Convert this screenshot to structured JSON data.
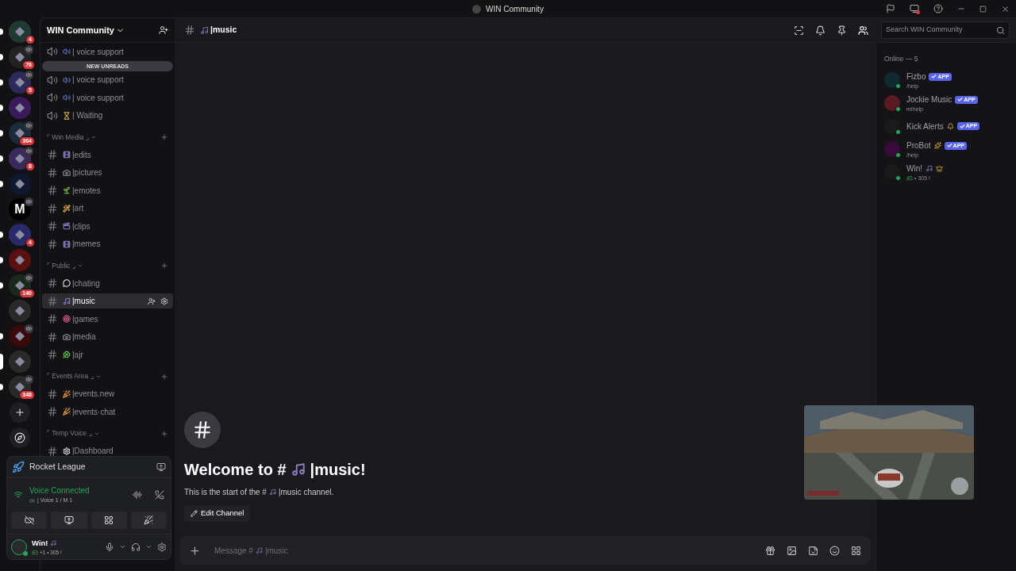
{
  "window": {
    "title": "WIN Community"
  },
  "servers": [
    {
      "badge": "4",
      "unread": true,
      "selected": false,
      "speaking": false
    },
    {
      "badge": "76",
      "unread": true,
      "selected": false,
      "speaking": true
    },
    {
      "badge": "5",
      "unread": true,
      "selected": false,
      "speaking": true
    },
    {
      "unread": true,
      "selected": false,
      "speaking": false
    },
    {
      "badge": "364",
      "unread": true,
      "selected": false,
      "speaking": true
    },
    {
      "badge": "8",
      "unread": true,
      "selected": false,
      "speaking": true
    },
    {
      "unread": true,
      "selected": false,
      "speaking": false
    },
    {
      "label": "M",
      "unread": false,
      "selected": false,
      "speaking": true
    },
    {
      "badge": "4",
      "unread": true,
      "selected": false,
      "speaking": false
    },
    {
      "unread": true,
      "selected": false,
      "speaking": false
    },
    {
      "badge": "140",
      "unread": true,
      "selected": false,
      "speaking": true
    },
    {
      "unread": false,
      "selected": false,
      "speaking": false
    },
    {
      "unread": true,
      "selected": false,
      "speaking": true
    },
    {
      "unread": false,
      "selected": true,
      "speaking": false
    },
    {
      "badge": "348",
      "unread": true,
      "selected": false,
      "speaking": true
    }
  ],
  "sidebar": {
    "server_name": "WIN Community",
    "new_unreads": "NEW UNREADS",
    "groups": [
      {
        "items": [
          {
            "name": "| voice support",
            "kind": "voice",
            "selected": false
          },
          {
            "name": "| voice support",
            "kind": "voice",
            "selected": false
          },
          {
            "name": "| voice support",
            "kind": "voice",
            "selected": false
          },
          {
            "name": "| Waiting",
            "kind": "voice",
            "selected": false
          }
        ]
      },
      {
        "category": "⌜ Win Media ⌟",
        "items": [
          {
            "name": "|edits",
            "kind": "text",
            "selected": false
          },
          {
            "name": "|pictures",
            "kind": "text",
            "selected": false
          },
          {
            "name": "|emotes",
            "kind": "text",
            "selected": false
          },
          {
            "name": "|art",
            "kind": "text",
            "selected": false
          },
          {
            "name": "|clips",
            "kind": "text",
            "selected": false
          },
          {
            "name": "|memes",
            "kind": "text",
            "selected": false
          }
        ]
      },
      {
        "category": "⌜ Public ⌟",
        "items": [
          {
            "name": "|chating",
            "kind": "text",
            "selected": false
          },
          {
            "name": "|music",
            "kind": "text",
            "selected": true
          },
          {
            "name": "|games",
            "kind": "text",
            "selected": false
          },
          {
            "name": "|media",
            "kind": "text",
            "selected": false
          },
          {
            "name": "|ajr",
            "kind": "text",
            "selected": false
          }
        ]
      },
      {
        "category": "⌜ Events Area ⌟",
        "items": [
          {
            "name": "|events.new",
            "kind": "text",
            "selected": false
          },
          {
            "name": "|events·chat",
            "kind": "text",
            "selected": false
          }
        ]
      },
      {
        "category": "⌜ Temp Voice ⌟",
        "items": [
          {
            "name": "|Dashboard",
            "kind": "text",
            "selected": false
          }
        ]
      }
    ]
  },
  "voice_panel": {
    "activity": "Rocket League",
    "status": "Voice Connected",
    "channel": "| Voice 1 / M 1"
  },
  "user": {
    "name": "Win!",
    "status": "+1 • 305 !"
  },
  "header": {
    "channel": "|music",
    "search_placeholder": "Search WIN Community"
  },
  "welcome": {
    "title_start": "Welcome to #",
    "title_end": "|music!",
    "subtitle": "This is the start of the #",
    "subtitle_end": "|music channel.",
    "edit_button": "Edit Channel"
  },
  "composer": {
    "placeholder_start": "Message #",
    "placeholder_end": "|music"
  },
  "members": {
    "heading": "Online — 5",
    "list": [
      {
        "name": "Fizbo",
        "tag": "APP",
        "status": "/help"
      },
      {
        "name": "Jockie Music",
        "tag": "APP",
        "status": "m!help"
      },
      {
        "name": "Kick Alerts",
        "tag": "APP"
      },
      {
        "name": "ProBot",
        "tag": "APP",
        "status": "/help"
      },
      {
        "name": "Win!",
        "status": "• 305 !"
      }
    ]
  }
}
